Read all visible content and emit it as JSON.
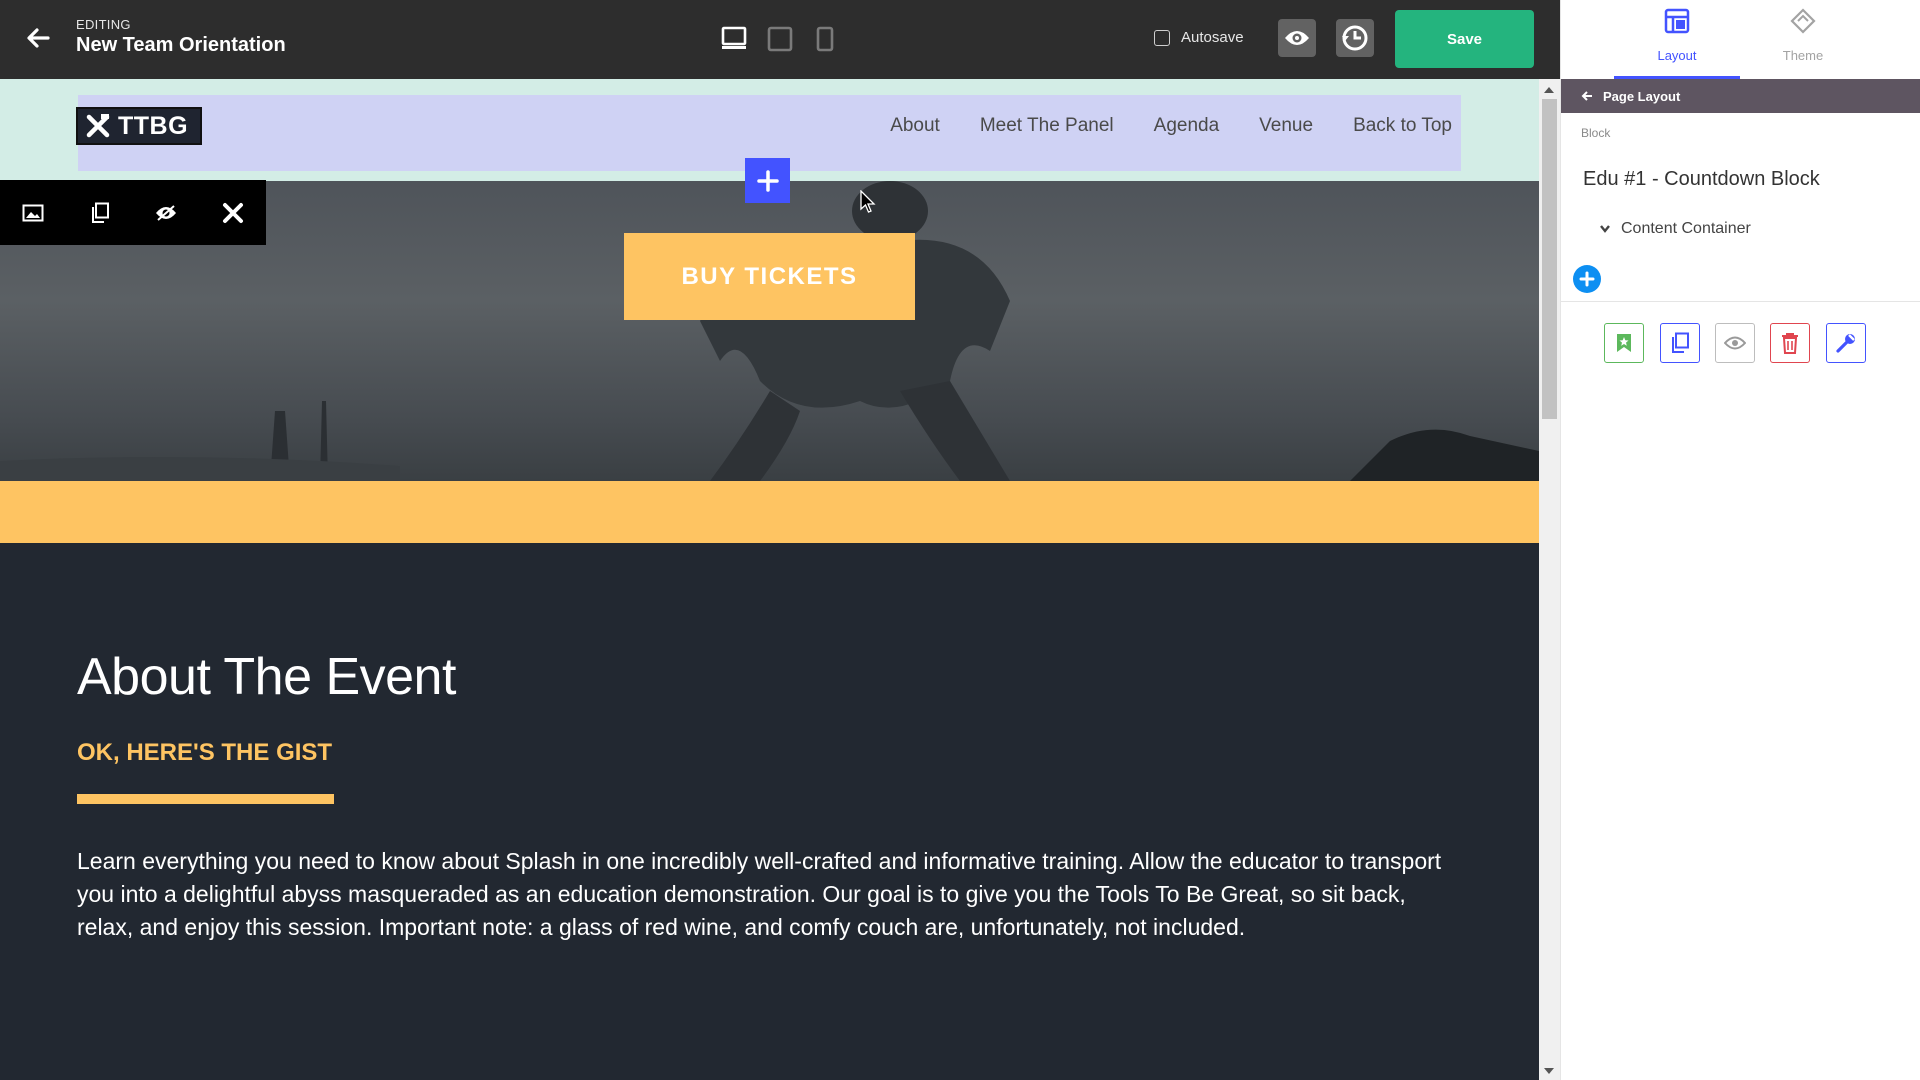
{
  "topbar": {
    "editing_label": "EDITING",
    "title": "New Team Orientation",
    "autosave_label": "Autosave",
    "save_label": "Save"
  },
  "site": {
    "logo_text": "TTBG",
    "nav": [
      "About",
      "Meet The Panel",
      "Agenda",
      "Venue",
      "Back to Top"
    ],
    "cta_label": "BUY TICKETS",
    "about_title": "About The Event",
    "about_subtitle": "OK, HERE'S THE GIST",
    "about_body": "Learn everything you need to know about Splash in one incredibly well-crafted and informative training. Allow the educator to transport you into a delightful abyss masqueraded as an education demonstration. Our goal is to give you the Tools To Be Great, so sit back, relax, and enjoy this session. Important note: a glass of red wine, and comfy couch are, unfortunately, not included."
  },
  "panel": {
    "tabs": [
      {
        "label": "Layout",
        "icon": "layout-icon",
        "active": true
      },
      {
        "label": "Theme",
        "icon": "theme-icon",
        "active": false
      }
    ],
    "breadcrumb": "Page Layout",
    "block_label": "Block",
    "block_title": "Edu #1 - Countdown Block",
    "container_label": "Content Container"
  },
  "colors": {
    "brand_yellow": "#fec462",
    "accent_blue": "#4353ff",
    "save_green": "#24b47e",
    "canvas_dark": "#222831",
    "panel_crumb": "#5e5561"
  }
}
